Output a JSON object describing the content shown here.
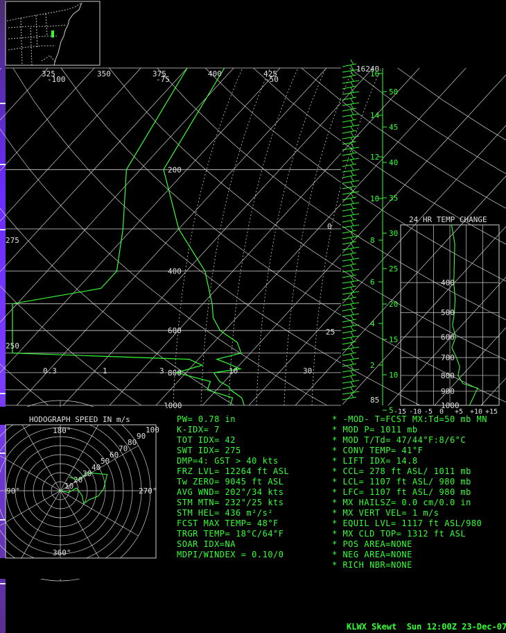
{
  "colors": {
    "background": "#000000",
    "trace": "#33ff33",
    "grid": "#cfcfcf",
    "text": "#33ff33",
    "label": "#e0e0e0"
  },
  "map_inset": {
    "icon": "us-east-coast-map-icon",
    "station_marker": "green-marker-icon"
  },
  "skewt": {
    "theta_labels": [
      "325",
      "350",
      "375",
      "400",
      "425"
    ],
    "temp_labels_top": [
      "-100",
      "-75",
      "-50"
    ],
    "temp_label_left": "275",
    "temp_labels_mid": [
      "0",
      "25"
    ],
    "pressure_labels": [
      "200",
      "400",
      "600",
      "800",
      "1000"
    ],
    "mixing_ratio_labels": [
      "0.3",
      "1",
      "3",
      "10",
      "30"
    ],
    "theta_label_low": "250",
    "top_height_label": "16240",
    "km_labels": [
      "16",
      "14",
      "12",
      "10",
      "8",
      "6",
      "4",
      "2"
    ],
    "kft_labels": [
      "50",
      "45",
      "40",
      "35",
      "30",
      "25",
      "20",
      "15",
      "10",
      "5"
    ],
    "bottom_height_label": "85"
  },
  "chart_data": [
    {
      "type": "line",
      "title": "",
      "xlabel": "",
      "ylabel": "",
      "y_scale": "log-pressure",
      "series": [
        {
          "values": [
            [
              100,
              -62
            ],
            [
              200,
              -55
            ],
            [
              300,
              -40
            ],
            [
              400,
              -26
            ],
            [
              500,
              -18
            ],
            [
              550,
              -15
            ],
            [
              600,
              -11
            ],
            [
              650,
              -5
            ],
            [
              700,
              -2
            ],
            [
              730,
              -6
            ],
            [
              750,
              -3
            ],
            [
              780,
              1
            ],
            [
              800,
              -4
            ],
            [
              850,
              -1
            ],
            [
              880,
              2
            ],
            [
              900,
              3
            ],
            [
              950,
              7
            ],
            [
              1000,
              9
            ]
          ]
        },
        {
          "values": [
            [
              100,
              -70
            ],
            [
              200,
              -63
            ],
            [
              300,
              -52
            ],
            [
              400,
              -45
            ],
            [
              450,
              -45
            ],
            [
              500,
              -80
            ],
            [
              580,
              -95
            ],
            [
              620,
              -75
            ],
            [
              680,
              -100
            ],
            [
              700,
              -92
            ],
            [
              730,
              -12
            ],
            [
              760,
              -8
            ],
            [
              800,
              -12
            ],
            [
              850,
              -3
            ],
            [
              900,
              -2
            ],
            [
              950,
              5
            ],
            [
              1000,
              6
            ]
          ]
        }
      ]
    },
    {
      "type": "line",
      "title": "24 HR TEMP CHANGE",
      "xlabel": "",
      "ylabel": "",
      "xlim": [
        -15,
        15
      ],
      "x_ticks": [
        "-15",
        "-10",
        "-5",
        "0",
        "+5",
        "+10",
        "+15"
      ],
      "y_labels": [
        "400",
        "500",
        "600",
        "700",
        "800",
        "900",
        "1000"
      ],
      "series": [
        {
          "values": [
            [
              100,
              0.5
            ],
            [
              300,
              1.5
            ],
            [
              400,
              1.2
            ],
            [
              450,
              1.6
            ],
            [
              500,
              1.4
            ],
            [
              550,
              0.8
            ],
            [
              600,
              1.8
            ],
            [
              650,
              0.6
            ],
            [
              700,
              2.0
            ],
            [
              750,
              3.0
            ],
            [
              800,
              2.5
            ],
            [
              850,
              4.0
            ],
            [
              880,
              8.5
            ],
            [
              900,
              8.0
            ],
            [
              950,
              7.0
            ],
            [
              1000,
              6.0
            ]
          ]
        }
      ]
    },
    {
      "type": "scatter",
      "title": "HODOGRAPH SPEED IN m/s",
      "direction_labels": [
        "180°",
        "90°",
        "270°",
        "360°"
      ],
      "ring_labels": [
        "10",
        "20",
        "30",
        "40",
        "50",
        "60",
        "70",
        "80",
        "90",
        "100"
      ],
      "series": [
        {
          "values": [
            [
              0,
              0
            ],
            [
              9,
              2
            ],
            [
              18,
              -3
            ],
            [
              24,
              5
            ],
            [
              26,
              14
            ],
            [
              32,
              10
            ],
            [
              42,
              6
            ],
            [
              48,
              -2
            ],
            [
              52,
              -18
            ],
            [
              30,
              -20
            ],
            [
              20,
              -12
            ],
            [
              10,
              -15
            ]
          ]
        }
      ]
    }
  ],
  "indices": [
    "PW= 0.78 in",
    "K-IDX= 7",
    "TOT IDX= 42",
    "SWT IDX= 275",
    "DMP=4: GST > 40 kts",
    "FRZ LVL= 12264 ft ASL",
    "Tw ZERO= 9045 ft ASL",
    "AVG WND= 202°/34 kts",
    "STM MTN= 232°/25 kts",
    "STM HEL= 436 m²/s²",
    "FCST MAX TEMP= 48°F",
    "TRGR TEMP= 18°C/64°F",
    "SOAR IDX=NA",
    "MDPI/WINDEX = 0.10/0"
  ],
  "parcel": [
    "* -MOD- T=FCST MX:Td=50 mb MN",
    "* MOD P= 1011 mb",
    "* MOD T/Td= 47/44°F:8/6°C",
    "* CONV TEMP= 41°F",
    "* LIFT IDX= 14.8",
    "* CCL= 278 ft ASL/ 1011 mb",
    "* LCL= 1107 ft ASL/ 980 mb",
    "* LFC= 1107 ft ASL/ 980 mb",
    "* MX HAILSZ= 0.0 cm/0.0 in",
    "* MX VERT VEL= 1 m/s",
    "* EQUIL LVL= 1117 ft ASL/980",
    "* MX CLD TOP= 1312 ft ASL",
    "* POS AREA=NONE",
    "* NEG AREA=NONE",
    "* RICH NBR=NONE"
  ],
  "footer": "KLWX Skewt  Sun 12:00Z 23-Dec-07"
}
